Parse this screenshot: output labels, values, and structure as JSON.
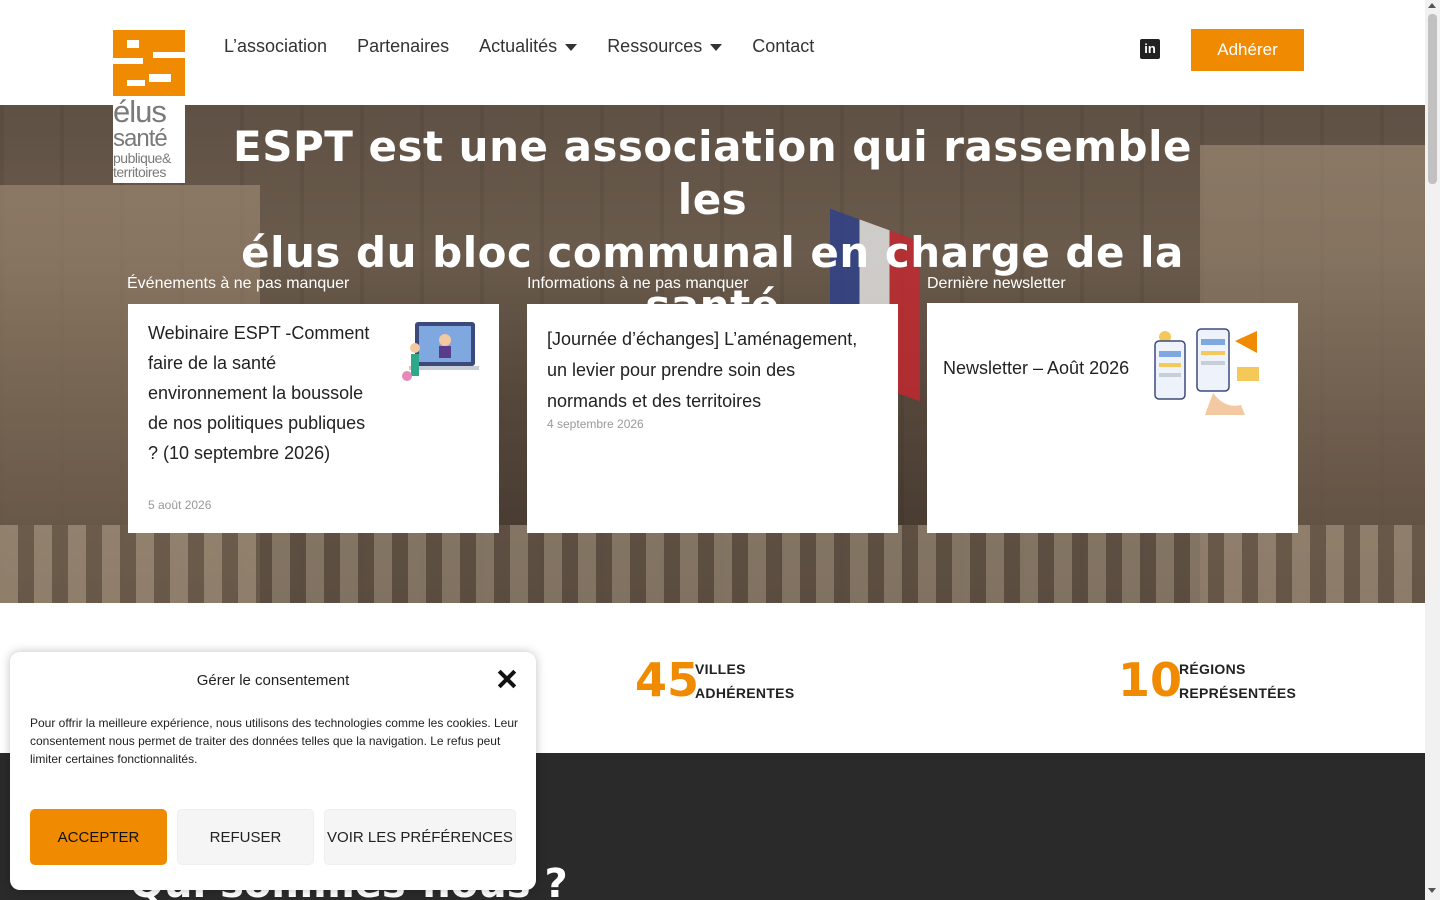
{
  "logo": {
    "line1": "élus",
    "line2": "santé",
    "line3": "publique&",
    "line4": "territoires"
  },
  "nav": {
    "items": [
      {
        "label": "L’association"
      },
      {
        "label": "Partenaires"
      },
      {
        "label": "Actualités"
      },
      {
        "label": "Ressources"
      },
      {
        "label": "Contact"
      }
    ],
    "linkedin_icon": "linkedin-icon",
    "cta": "Adhérer"
  },
  "hero": {
    "title_line1": "ESPT est une association qui rassemble les",
    "title_line2": "élus du bloc communal en charge de la santé",
    "columns": [
      {
        "label": "Événements à ne pas manquer",
        "card_title": "Webinaire ESPT -Comment faire de la santé environnement la boussole de nos politiques publiques ? (10 septembre 2026)",
        "card_date": "5 août 2026"
      },
      {
        "label": "Informations à ne pas manquer",
        "card_title": "[Journée d’échanges] L’aménagement, un levier pour prendre soin des normands et des territoires",
        "card_date": "4 septembre 2026"
      },
      {
        "label": "Dernière newsletter",
        "card_title": "Newsletter – Août 2026"
      }
    ]
  },
  "stats": [
    {
      "number": "45",
      "label1": "VILLES",
      "label2": "ADHÉRENTES"
    },
    {
      "number": "10",
      "label1": "RÉGIONS",
      "label2": "REPRÉSENTÉES"
    }
  ],
  "section": {
    "title": "Qui sommes-nous ?"
  },
  "consent": {
    "title": "Gérer le consentement",
    "text": "Pour offrir la meilleure expérience, nous utilisons des technologies comme les cookies. Leur consentement nous permet de traiter des données telles que la navigation. Le refus peut limiter certaines fonctionnalités.",
    "accept": "ACCEPTER",
    "refuse": "REFUSER",
    "preferences": "VOIR LES PRÉFÉRENCES"
  },
  "colors": {
    "accent": "#f08a00",
    "dark": "#2a2a2a"
  }
}
